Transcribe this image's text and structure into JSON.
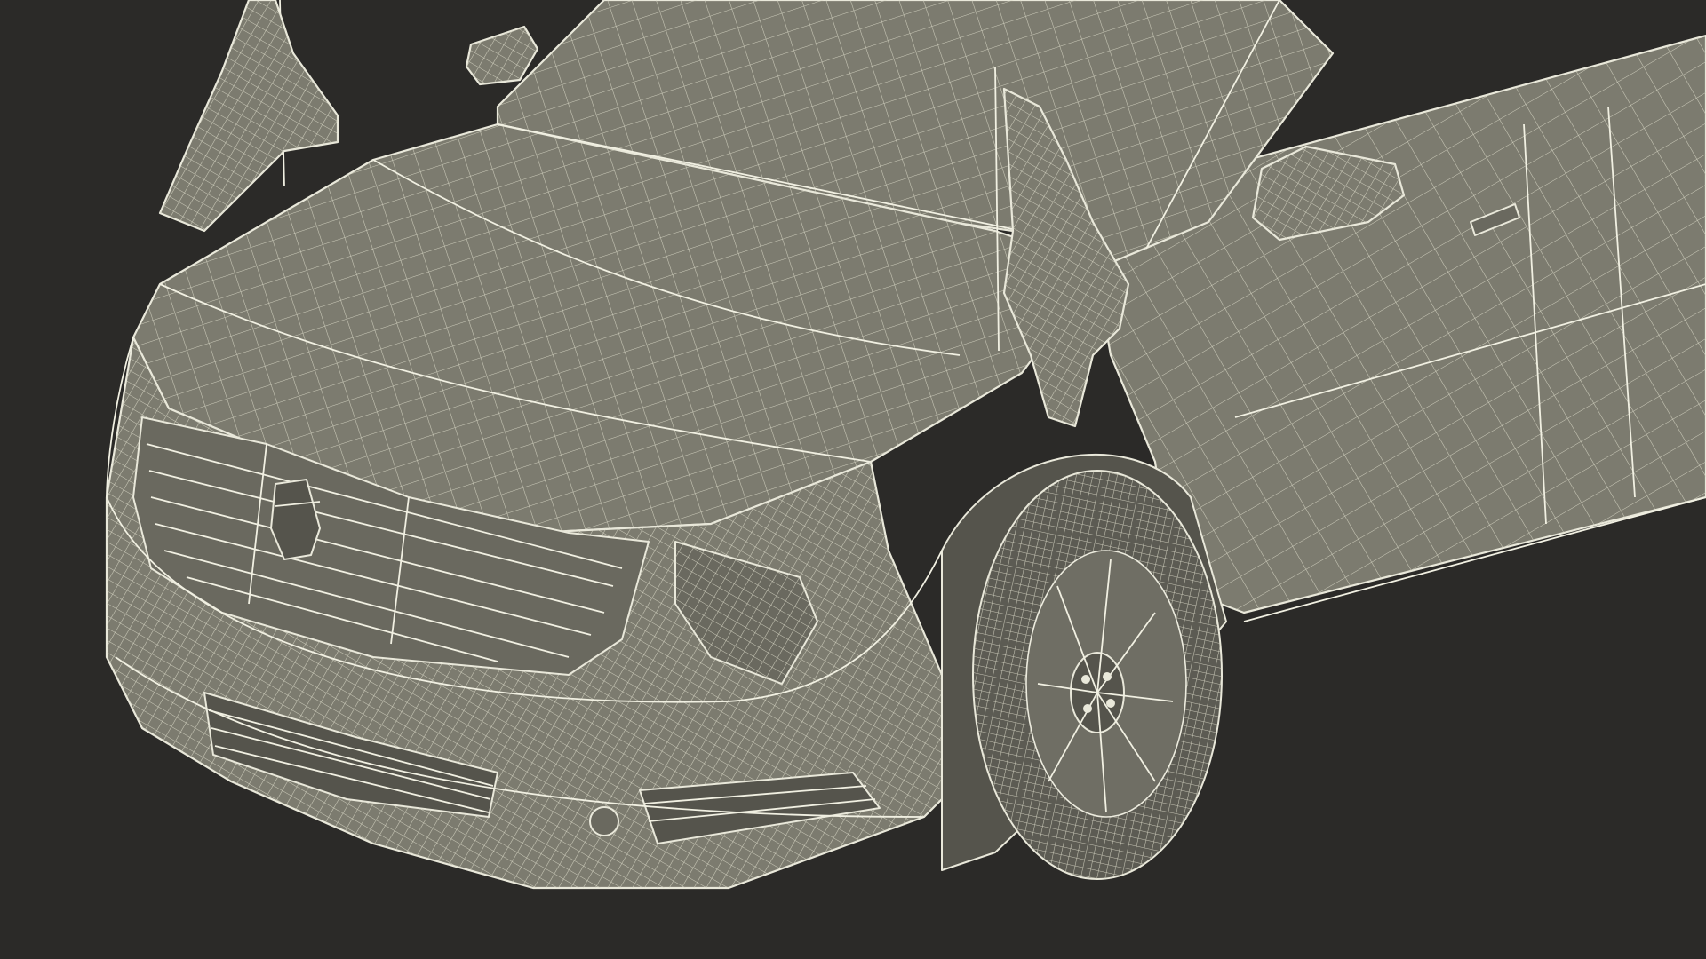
{
  "scene": {
    "subject": "car-wireframe",
    "background_color": "#2b2a28",
    "mesh_fill_color": "#7c7b6f",
    "wire_color": "#e9e8da"
  }
}
